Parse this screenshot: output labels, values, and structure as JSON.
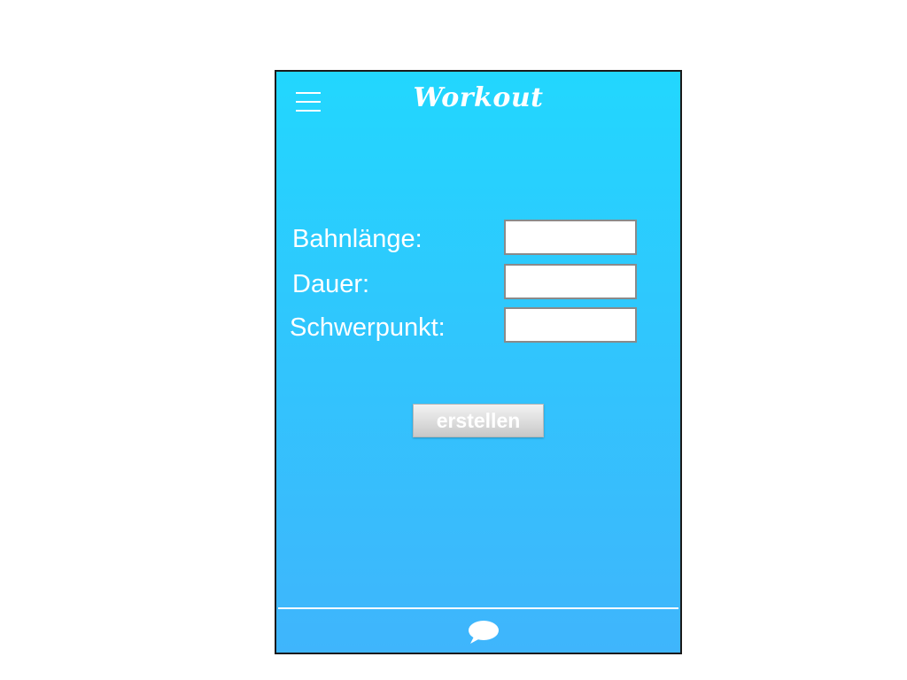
{
  "header": {
    "title": "Workout",
    "menu_icon": "hamburger-menu-icon"
  },
  "form": {
    "fields": [
      {
        "label": "Bahnlänge:",
        "value": ""
      },
      {
        "label": "Dauer:",
        "value": ""
      },
      {
        "label": "Schwerpunkt:",
        "value": ""
      }
    ],
    "submit_label": "erstellen"
  },
  "footer": {
    "chat_icon": "speech-bubble-icon"
  },
  "colors": {
    "gradient_top": "#22d7fe",
    "gradient_bottom": "#3fb5fc",
    "button_bg": "#dcdcdc"
  }
}
